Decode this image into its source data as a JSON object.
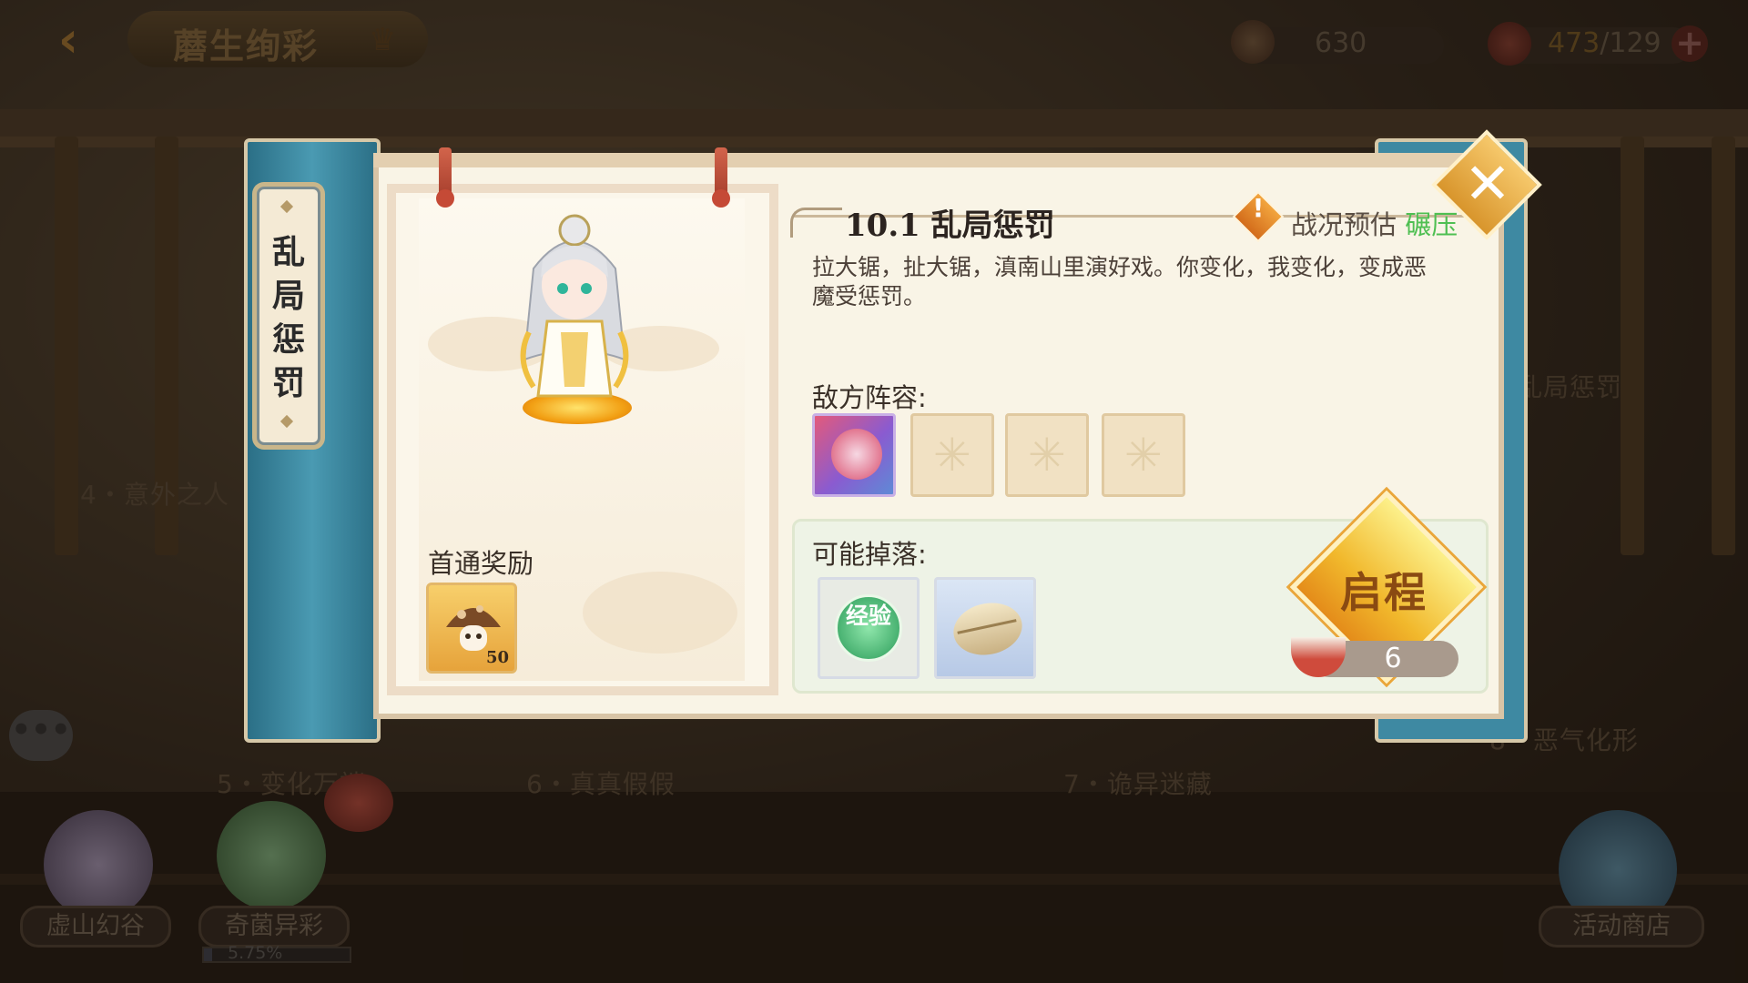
{
  "hud": {
    "title": "蘑生绚彩",
    "resource1": "630",
    "stamina_current": "473",
    "stamina_sep_max": "/129"
  },
  "background": {
    "stage_labels": [
      "4・意外之人",
      "5・变化万端",
      "6・真真假假",
      "7・诡异迷藏",
      "8・恶气化形",
      "乱局惩罚"
    ],
    "nodes": [
      "虚山幻谷",
      "奇菌异彩",
      "活动商店"
    ],
    "progress_text": "5.75%",
    "progress_value": 0.0575
  },
  "dialog": {
    "vertical_title": "乱局惩罚",
    "first_clear_label": "首通奖励",
    "reward_count": "50",
    "stage_title": "10.1 乱局惩罚",
    "status_label": "战况预估",
    "status_value": "碾压",
    "description": "拉大锯，扯大锯，滇南山里演好戏。你变化，我变化，变成恶魔受惩罚。",
    "enemy_label": "敌方阵容:",
    "drop_label": "可能掉落:",
    "exp_item": "经验",
    "start_label": "启程",
    "cost": "6"
  },
  "colors": {
    "status_green": "#4fbf52",
    "teal_strip": "#3e89a2",
    "gold": "#f1b82c"
  }
}
